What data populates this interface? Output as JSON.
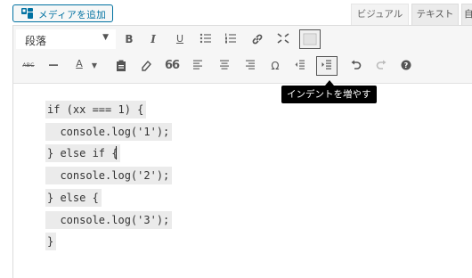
{
  "header": {
    "add_media_label": "メディアを追加",
    "tabs": {
      "visual": "ビジュアル",
      "text": "テキスト",
      "edge": "自"
    }
  },
  "toolbar": {
    "format_value": "段落",
    "bold": "B",
    "italic": "I",
    "underline": "U",
    "abc": "ABC",
    "text_color": "A",
    "quote": "66",
    "omega": "Ω"
  },
  "tooltip": {
    "text": "インデントを増やす"
  },
  "editor": {
    "lines": [
      "if (xx === 1) {",
      "  console.log('1');",
      "} else if {",
      "  console.log('2');",
      "} else {",
      "  console.log('3');",
      "}"
    ]
  },
  "colors": {
    "accent": "#0071a1",
    "tooltip_bg": "#000000",
    "code_bg": "#ebebeb"
  }
}
